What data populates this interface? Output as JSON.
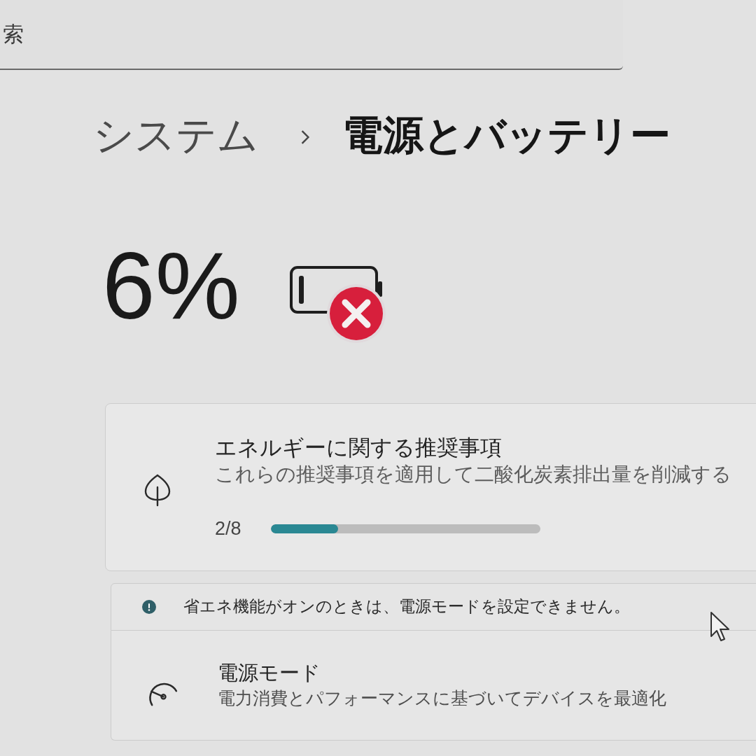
{
  "search": {
    "placeholder": "索"
  },
  "breadcrumb": {
    "parent": "システム",
    "current": "電源とバッテリー"
  },
  "battery": {
    "percent": "6%"
  },
  "recommendations": {
    "title": "エネルギーに関する推奨事項",
    "subtitle": "これらの推奨事項を適用して二酸化炭素排出量を削減する",
    "progress": "2/8",
    "level": 0.25
  },
  "notice": {
    "text": "省エネ機能がオンのときは、電源モードを設定できません。"
  },
  "settings": [
    {
      "kind": "power-mode",
      "title": "電源モード",
      "description": "電力消費とパフォーマンスに基づいてデバイスを最適化"
    }
  ]
}
